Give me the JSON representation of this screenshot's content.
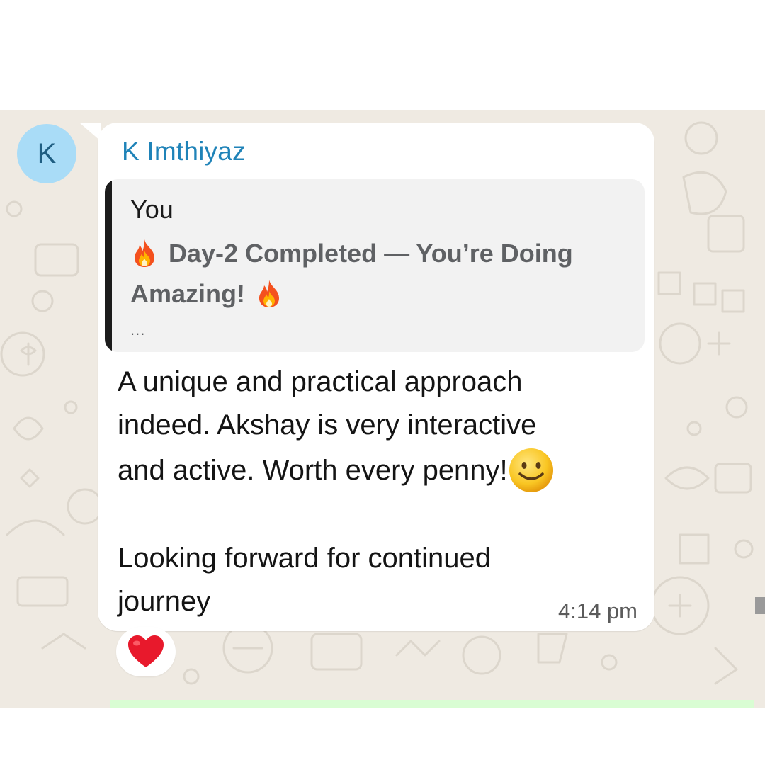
{
  "message": {
    "avatar_initial": "K",
    "sender_name": "K Imthiyaz",
    "quoted": {
      "author": "You",
      "text": "Day-2 Completed — You’re Doing Amazing!",
      "text_part1": "Day-2 Completed — You’re Doing",
      "text_part2": "Amazing!",
      "truncation": "...",
      "emoji": "fire-icon"
    },
    "body_line1": "A unique and practical approach",
    "body_line2": "indeed. Akshay is very interactive",
    "body_line3": "and active. Worth every penny!",
    "body_line4": "Looking forward for continued",
    "body_line5": "journey",
    "body_emoji": "smiley-icon",
    "time": "4:14 pm",
    "reaction": "heart-icon"
  },
  "colors": {
    "chat_background": "#efeae2",
    "bubble": "#ffffff",
    "sender_name": "#1f83b8",
    "avatar_bg": "#a9dcf7",
    "quote_bar": "#1c1c1c",
    "quote_bg": "#f2f2f2",
    "outgoing_bubble": "#d9fdd3"
  }
}
